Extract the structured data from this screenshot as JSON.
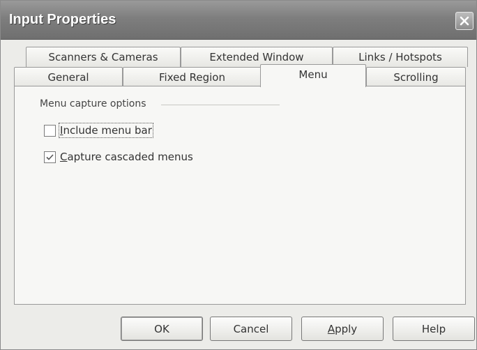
{
  "window": {
    "title": "Input Properties"
  },
  "tabs": {
    "row_back": [
      {
        "label": "Scanners & Cameras"
      },
      {
        "label": "Extended Window"
      },
      {
        "label": "Links / Hotspots"
      }
    ],
    "row_front": [
      {
        "label": "General"
      },
      {
        "label": "Fixed Region"
      },
      {
        "label": "Menu",
        "active": true
      },
      {
        "label": "Scrolling"
      }
    ]
  },
  "menu_panel": {
    "group_label": "Menu capture options",
    "include_menu_bar": {
      "mnemonic": "I",
      "rest": "nclude menu bar",
      "checked": false
    },
    "capture_cascaded": {
      "mnemonic": "C",
      "rest": "apture cascaded menus",
      "checked": true
    }
  },
  "buttons": {
    "ok": "OK",
    "cancel": "Cancel",
    "apply_mnemonic": "A",
    "apply_rest": "pply",
    "help": "Help"
  }
}
